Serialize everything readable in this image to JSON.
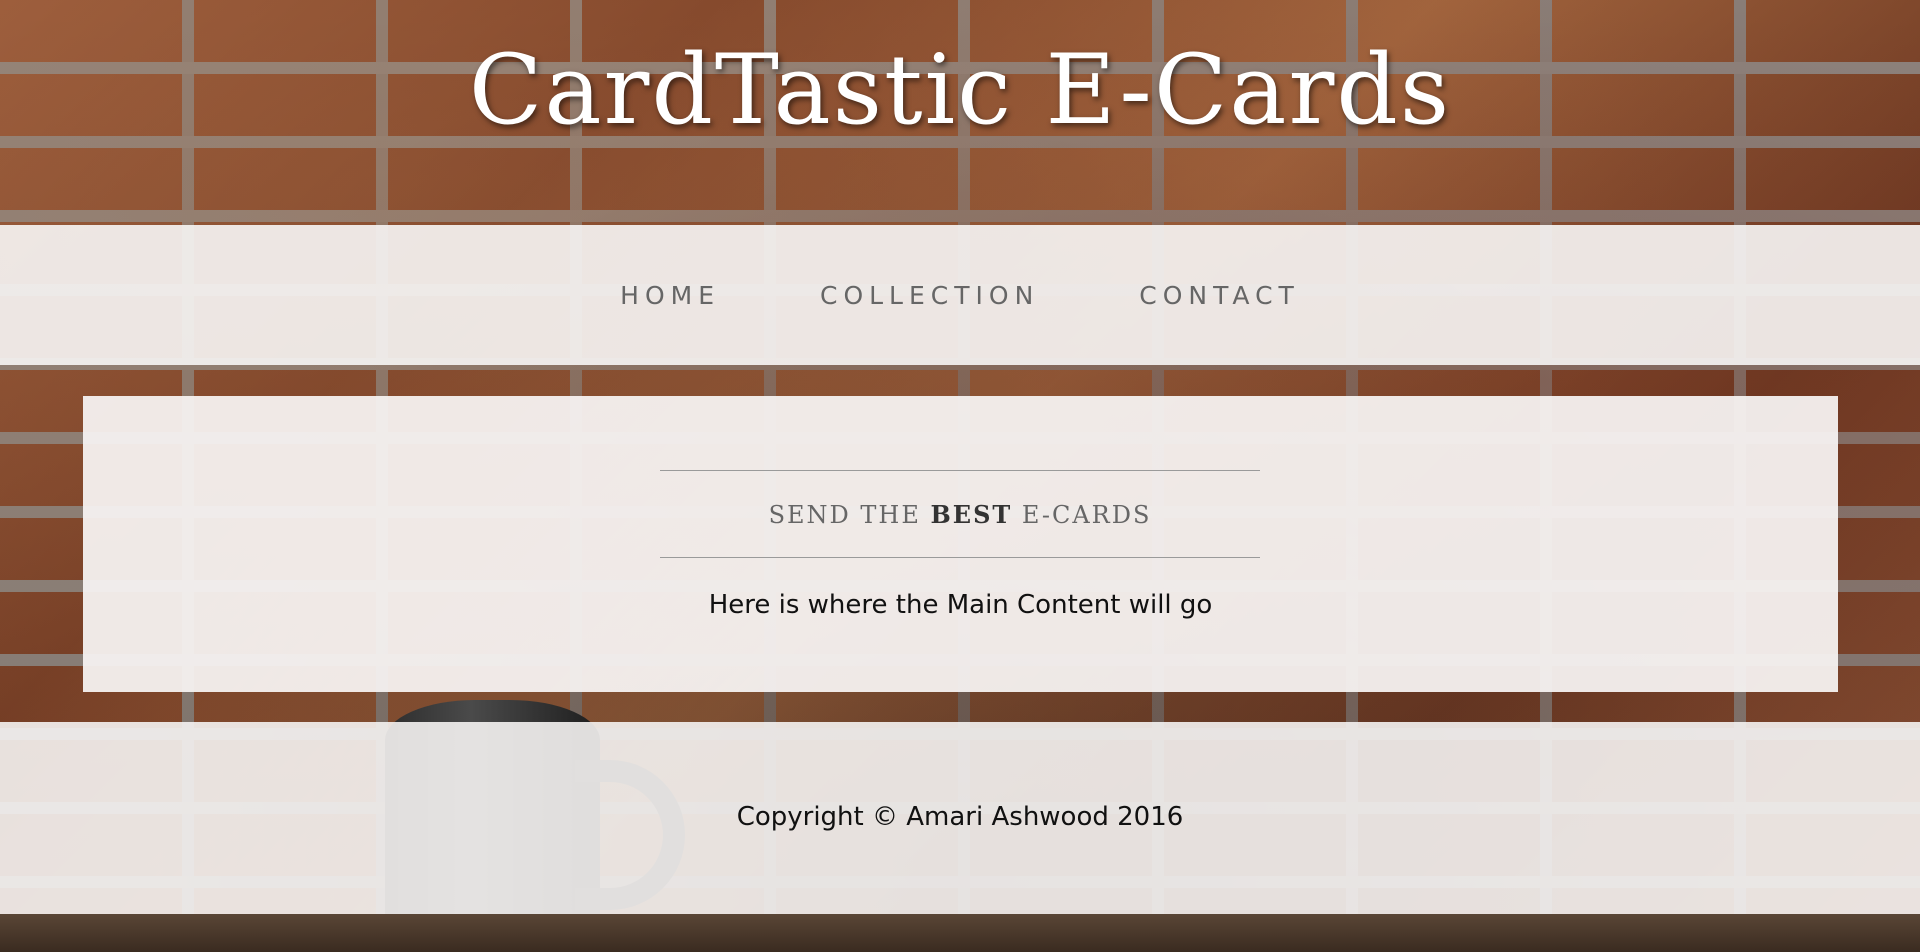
{
  "header": {
    "title": "CardTastic E-Cards"
  },
  "nav": {
    "items": [
      {
        "label": "HOME"
      },
      {
        "label": "COLLECTION"
      },
      {
        "label": "CONTACT"
      }
    ]
  },
  "main": {
    "tagline": {
      "before": "SEND THE ",
      "emphasis": "BEST",
      "after": " E-CARDS"
    },
    "body_text": "Here is where the Main Content will go"
  },
  "footer": {
    "copyright": "Copyright © Amari Ashwood 2016"
  },
  "theme": {
    "panel_background": "#f6f3f2",
    "nav_text_color": "#666666",
    "title_color": "#ffffff",
    "background_image": "brick-wall-with-mug"
  }
}
